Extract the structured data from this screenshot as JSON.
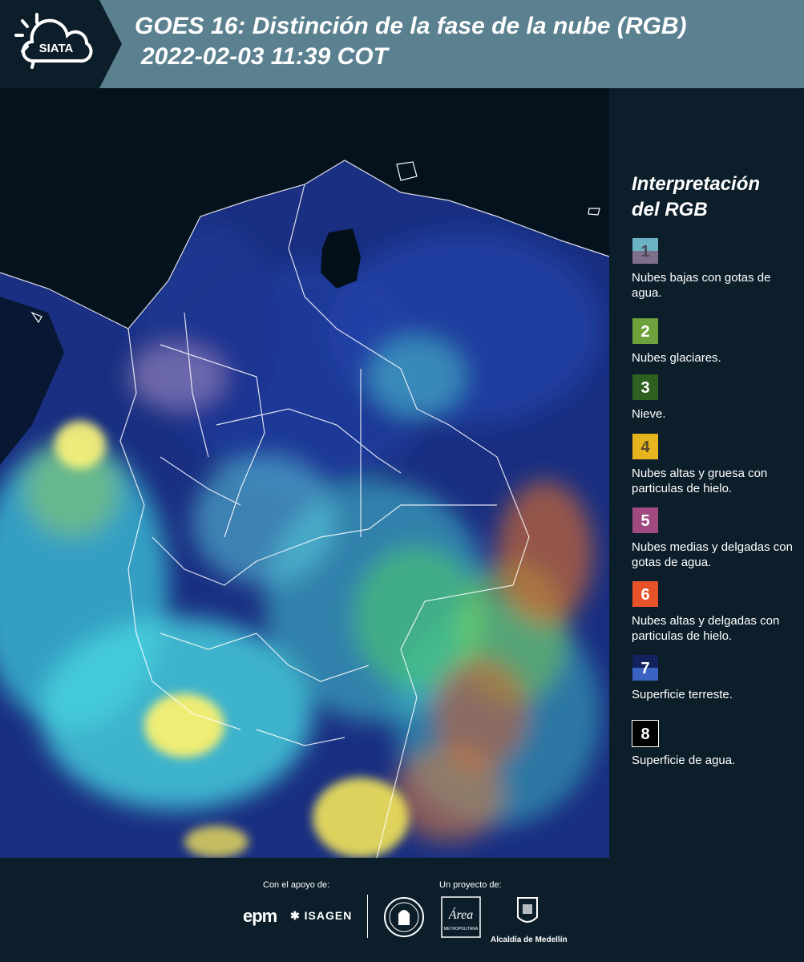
{
  "header": {
    "logo_text": "SIATA",
    "title_line1": "GOES 16: Distinción de la fase de la nube (RGB)",
    "title_line2": "2022-02-03 11:39 COT"
  },
  "legend": {
    "title_line1": "Interpretación",
    "title_line2": "del RGB",
    "items": [
      {
        "num": "1",
        "text": "Nubes bajas con gotas de agua.",
        "color_top": "#6bb3c4",
        "color_bottom": "#7e6f8c",
        "num_color": "#4a4a5a"
      },
      {
        "num": "2",
        "text": "Nubes glaciares.",
        "color_top": "#6fa23c",
        "color_bottom": "#6fa23c",
        "num_color": "#ffffff"
      },
      {
        "num": "3",
        "text": "Nieve.",
        "color_top": "#2f6020",
        "color_bottom": "#2f6020",
        "num_color": "#ffffff"
      },
      {
        "num": "4",
        "text": "Nubes altas y gruesa con particulas de hielo.",
        "color_top": "#e6b41e",
        "color_bottom": "#e6b41e",
        "num_color": "#5a4a2a"
      },
      {
        "num": "5",
        "text": "Nubes medias y delgadas con gotas de agua.",
        "color_top": "#a04a80",
        "color_bottom": "#a04a80",
        "num_color": "#ffffff"
      },
      {
        "num": "6",
        "text": "Nubes altas y delgadas con particulas de hielo.",
        "color_top": "#e8522a",
        "color_bottom": "#e8522a",
        "num_color": "#ffffff"
      },
      {
        "num": "7",
        "text": "Superficie terreste.",
        "color_top": "#11225e",
        "color_bottom": "#3a62c0",
        "num_color": "#ffffff"
      },
      {
        "num": "8",
        "text": "Superficie de agua.",
        "color_top": "#000000",
        "color_bottom": "#000000",
        "num_color": "#ffffff"
      }
    ]
  },
  "footer": {
    "support_label": "Con el apoyo de:",
    "project_label": "Un proyecto de:",
    "sponsor1": "epm",
    "sponsor2": "ISAGEN",
    "partner_area": "Área",
    "partner_area_sub": "METROPOLITANA",
    "partner_alcaldia": "Alcaldía de Medellín"
  }
}
